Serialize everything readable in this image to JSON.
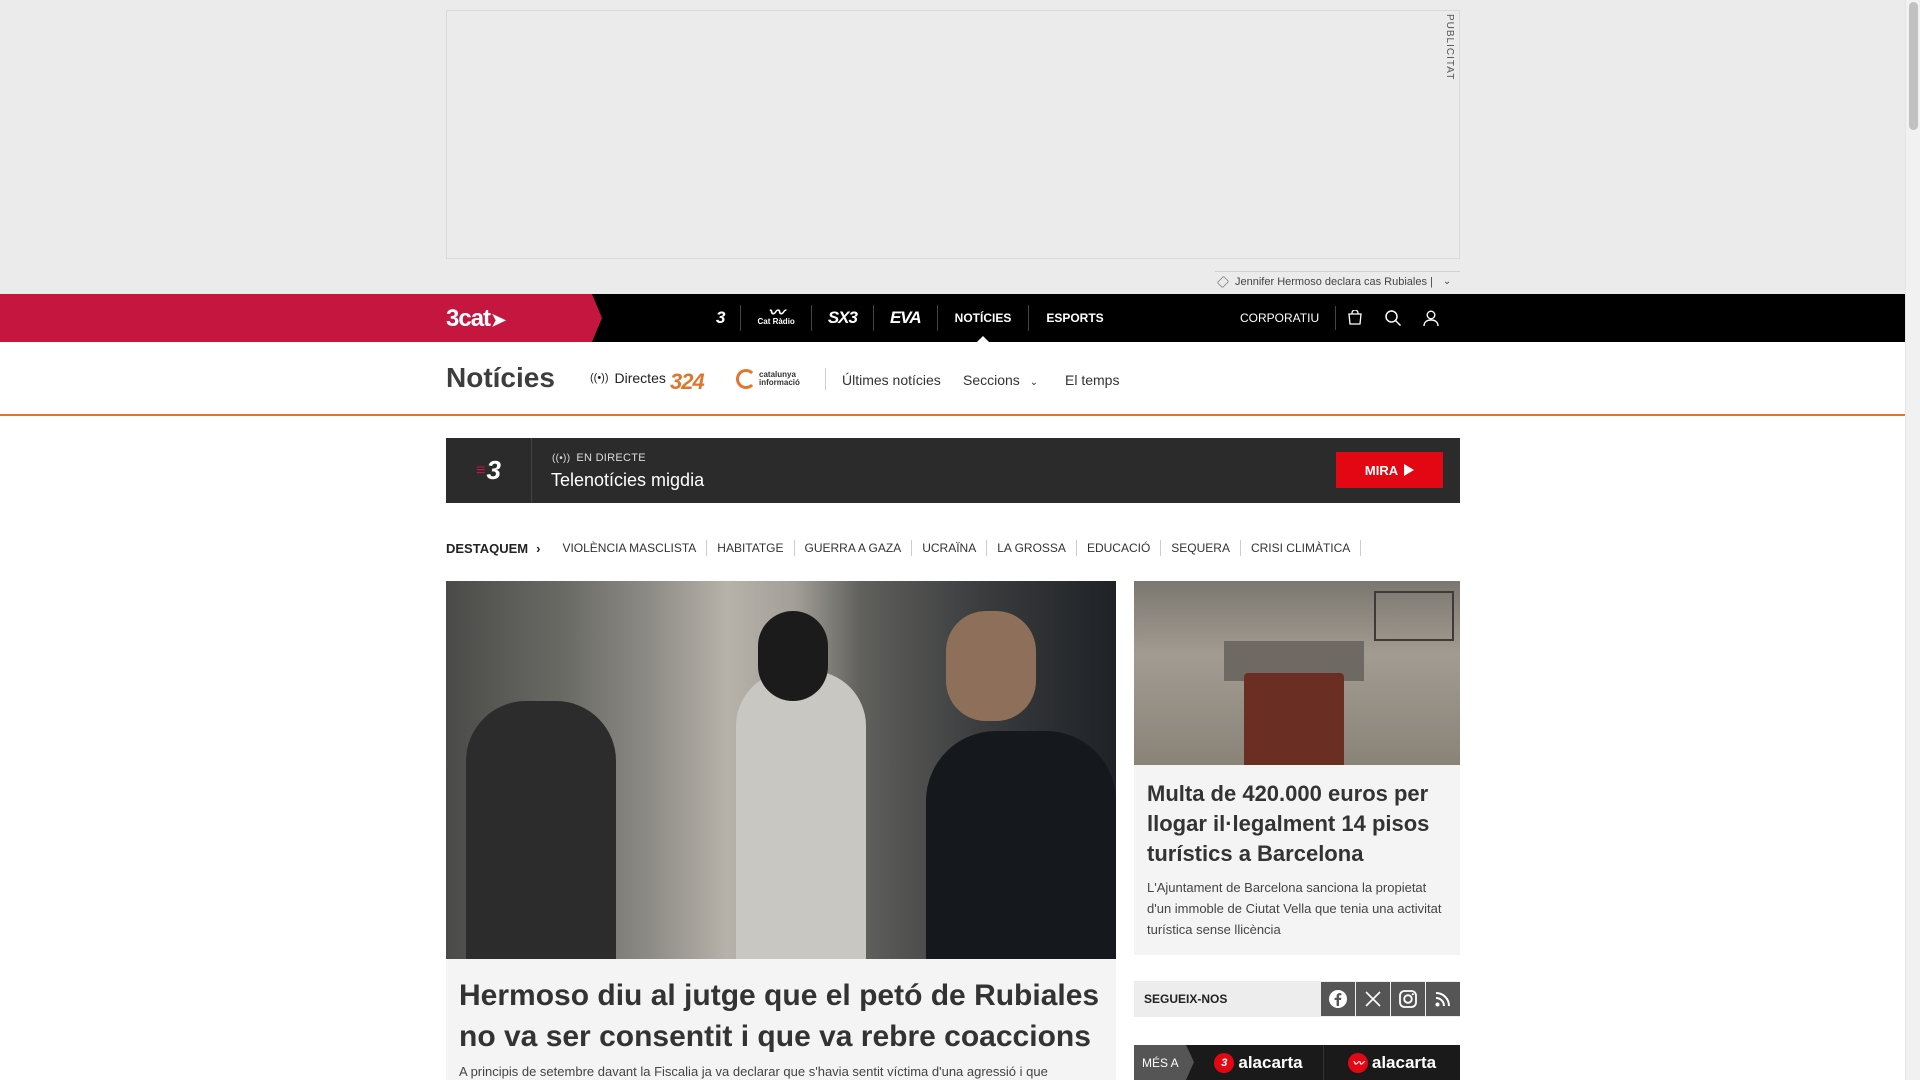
{
  "ad": {
    "label": "PUBLICITAT",
    "ticker_text": "Jennifer Hermoso declara cas Rubiales |"
  },
  "topbar": {
    "brand": "3cat",
    "channels": [
      {
        "label": "3",
        "icon": "tv3-logo"
      },
      {
        "label": "Cat Ràdio",
        "icon": "catradio-logo"
      },
      {
        "label": "SX3",
        "icon": "sx3-logo"
      },
      {
        "label": "EVA",
        "icon": "eva-logo"
      },
      {
        "label": "NOTÍCIES"
      },
      {
        "label": "ESPORTS"
      }
    ],
    "corporate": "CORPORATIU",
    "icons": [
      "shop-icon",
      "search-icon",
      "user-icon"
    ]
  },
  "subnav": {
    "title": "Notícies",
    "directes": "Directes",
    "logo_324": "324",
    "logo_cat_line1": "catalunya",
    "logo_cat_line2": "informació",
    "links": [
      "Últimes notícies",
      "Seccions",
      "El temps"
    ]
  },
  "live": {
    "channel": "3",
    "tag": "EN DIRECTE",
    "title": "Telenotícies migdia",
    "button": "MIRA"
  },
  "destaquem": {
    "heading": "DESTAQUEM",
    "tags": [
      "VIOLÈNCIA MASCLISTA",
      "HABITATGE",
      "GUERRA A GAZA",
      "UCRAÏNA",
      "LA GROSSA",
      "EDUCACIÓ",
      "SEQUERA",
      "CRISI CLIMÀTICA"
    ]
  },
  "main_article": {
    "title": "Hermoso diu al jutge que el petó de Rubiales no va ser consentit i que va rebre coaccions",
    "lead": "A principis de setembre davant la Fiscalia ja va declarar que s'havia sentit víctima d'una agressió i que"
  },
  "side_article": {
    "title": "Multa de 420.000 euros per llogar il·legalment 14 pisos turístics a Barcelona",
    "lead": "L'Ajuntament de Barcelona sanciona la propietat d'un immoble de Ciutat Vella que tenia una activitat turística sense llicència"
  },
  "follow": {
    "label": "SEGUEIX-NOS",
    "networks": [
      "facebook-icon",
      "x-icon",
      "instagram-icon",
      "rss-icon"
    ]
  },
  "alacarta": {
    "label": "MÉS A",
    "item1": "alacarta",
    "item2": "alacarta"
  },
  "colors": {
    "brand": "#c4163f",
    "accent_orange": "#e0762c",
    "live_red": "#e30613"
  }
}
